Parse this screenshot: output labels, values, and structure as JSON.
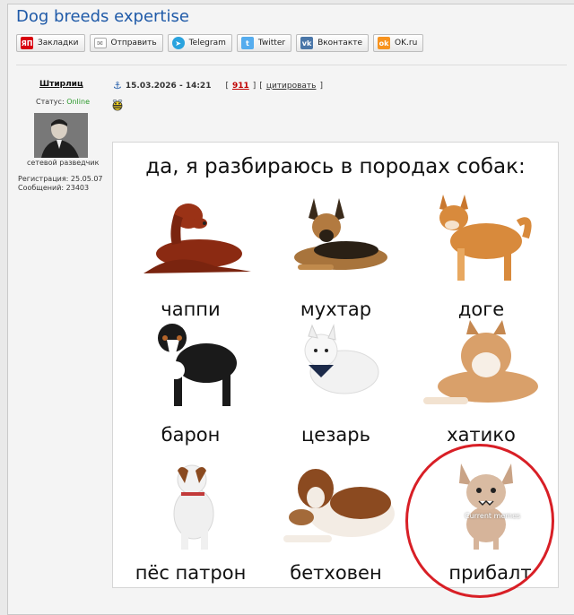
{
  "thread": {
    "title": "Dog breeds expertise"
  },
  "share": {
    "buttons": [
      {
        "label": "Закладки",
        "icon": "yandex-bookmarks-icon",
        "color": "#d8000f",
        "glyph": "ЯП"
      },
      {
        "label": "Отправить",
        "icon": "mail-icon",
        "color": "#9a9a9a",
        "glyph": "✉"
      },
      {
        "label": "Telegram",
        "icon": "telegram-icon",
        "color": "#2aa3de",
        "glyph": "➤"
      },
      {
        "label": "Twitter",
        "icon": "twitter-icon",
        "color": "#55acee",
        "glyph": "t"
      },
      {
        "label": "Вконтакте",
        "icon": "vk-icon",
        "color": "#4a76a8",
        "glyph": "vk"
      },
      {
        "label": "OK.ru",
        "icon": "ok-icon",
        "color": "#f7931e",
        "glyph": "ok"
      }
    ]
  },
  "post": {
    "author": "Штирлиц",
    "datetime": "15.03.2026 - 14:21",
    "reply_count": "911",
    "quote_label": "цитировать",
    "status_label": "Статус:",
    "status_value": "Online",
    "rank": "сетевой разведчик",
    "registration": "Регистрация: 25.05.07",
    "messages": "Сообщений: 23403"
  },
  "meme": {
    "header": "да, я разбираюсь в породах собак:",
    "watermark": "Current memes",
    "cells": [
      {
        "label": "чаппи",
        "color": "#8b2a12"
      },
      {
        "label": "мухтар",
        "color": "#7a5128"
      },
      {
        "label": "доге",
        "color": "#d88a3c"
      },
      {
        "label": "барон",
        "color": "#1a1a1a"
      },
      {
        "label": "цезарь",
        "color": "#f2f2f2"
      },
      {
        "label": "хатико",
        "color": "#d9a06a"
      },
      {
        "label": "пёс патрон",
        "color": "#f0f0f0"
      },
      {
        "label": "бетховен",
        "color": "#8b4a20"
      },
      {
        "label": "прибалт",
        "color": "#d6b49a"
      }
    ]
  },
  "colors": {
    "title": "#1f5aa8",
    "online": "#2c9a2c",
    "count": "#c00000",
    "highlight_ring": "#d81f26"
  }
}
